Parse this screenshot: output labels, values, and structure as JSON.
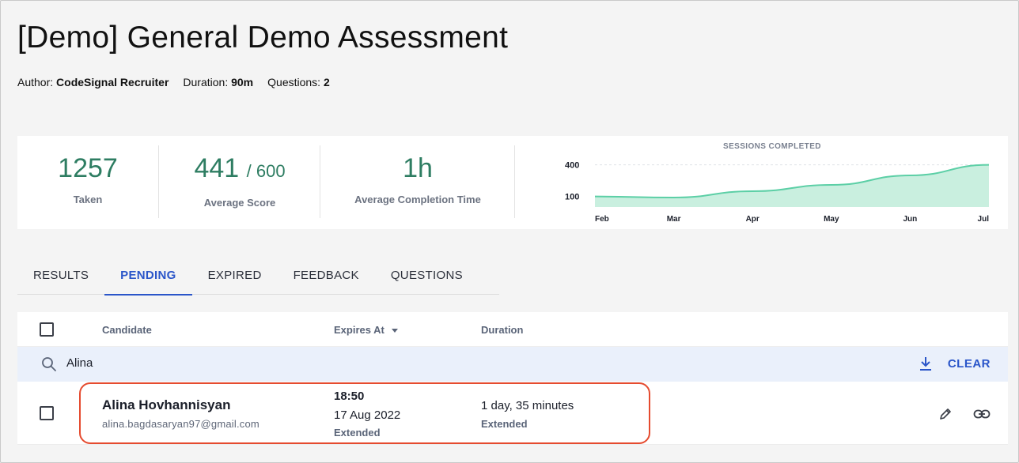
{
  "header": {
    "title": "[Demo] General Demo Assessment",
    "author_label": "Author:",
    "author": "CodeSignal Recruiter",
    "duration_label": "Duration:",
    "duration": "90m",
    "questions_label": "Questions:",
    "questions": "2"
  },
  "stats": {
    "taken": {
      "value": "1257",
      "label": "Taken"
    },
    "average_score": {
      "value": "441",
      "max": "/ 600",
      "label": "Average Score"
    },
    "avg_completion": {
      "value": "1h",
      "label": "Average Completion Time"
    }
  },
  "chart_data": {
    "type": "area",
    "title": "SESSIONS COMPLETED",
    "categories": [
      "Feb",
      "Mar",
      "Apr",
      "May",
      "Jun",
      "Jul"
    ],
    "y_ticks": [
      "400",
      "100"
    ],
    "series": [
      {
        "values": [
          100,
          90,
          150,
          210,
          300,
          400
        ]
      }
    ],
    "ylim": [
      0,
      420
    ],
    "fill_color": "#c9efdf",
    "line_color": "#5ccfa6"
  },
  "tabs": [
    {
      "label": "RESULTS",
      "active": false
    },
    {
      "label": "PENDING",
      "active": true
    },
    {
      "label": "EXPIRED",
      "active": false
    },
    {
      "label": "FEEDBACK",
      "active": false
    },
    {
      "label": "QUESTIONS",
      "active": false
    }
  ],
  "table": {
    "columns": {
      "candidate": "Candidate",
      "expires_at": "Expires At",
      "duration": "Duration"
    },
    "search": {
      "value": "Alina",
      "clear_label": "CLEAR"
    },
    "rows": [
      {
        "name": "Alina Hovhannisyan",
        "email": "alina.bagdasaryan97@gmail.com",
        "expires_time": "18:50",
        "expires_date": "17 Aug 2022",
        "expires_note": "Extended",
        "duration": "1 day, 35 minutes",
        "duration_note": "Extended"
      }
    ]
  },
  "icons": {
    "search": "search-icon",
    "download": "download-icon",
    "sort": "sort-down-icon",
    "edit": "pencil-icon",
    "link": "link-icon"
  },
  "colors": {
    "accent": "#2a55c9",
    "stat_green": "#2e7d62",
    "highlight": "#e54b2f"
  }
}
